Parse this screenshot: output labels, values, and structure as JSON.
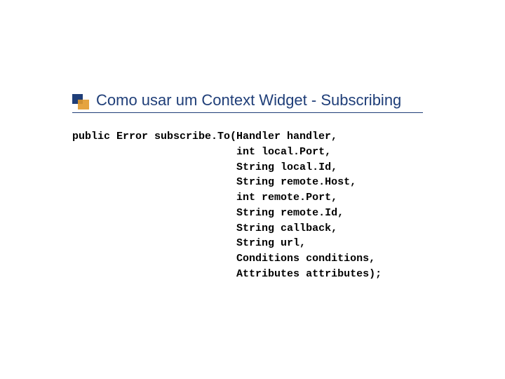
{
  "title": "Como usar um Context Widget - Subscribing",
  "code": {
    "line1": "public Error subscribe.To(Handler handler,",
    "indent_pad": "                          ",
    "args": [
      "int local.Port,",
      "String local.Id,",
      "String remote.Host,",
      "int remote.Port,",
      "String remote.Id,",
      "String callback,",
      "String url,",
      "Conditions conditions,",
      "Attributes attributes);"
    ]
  }
}
